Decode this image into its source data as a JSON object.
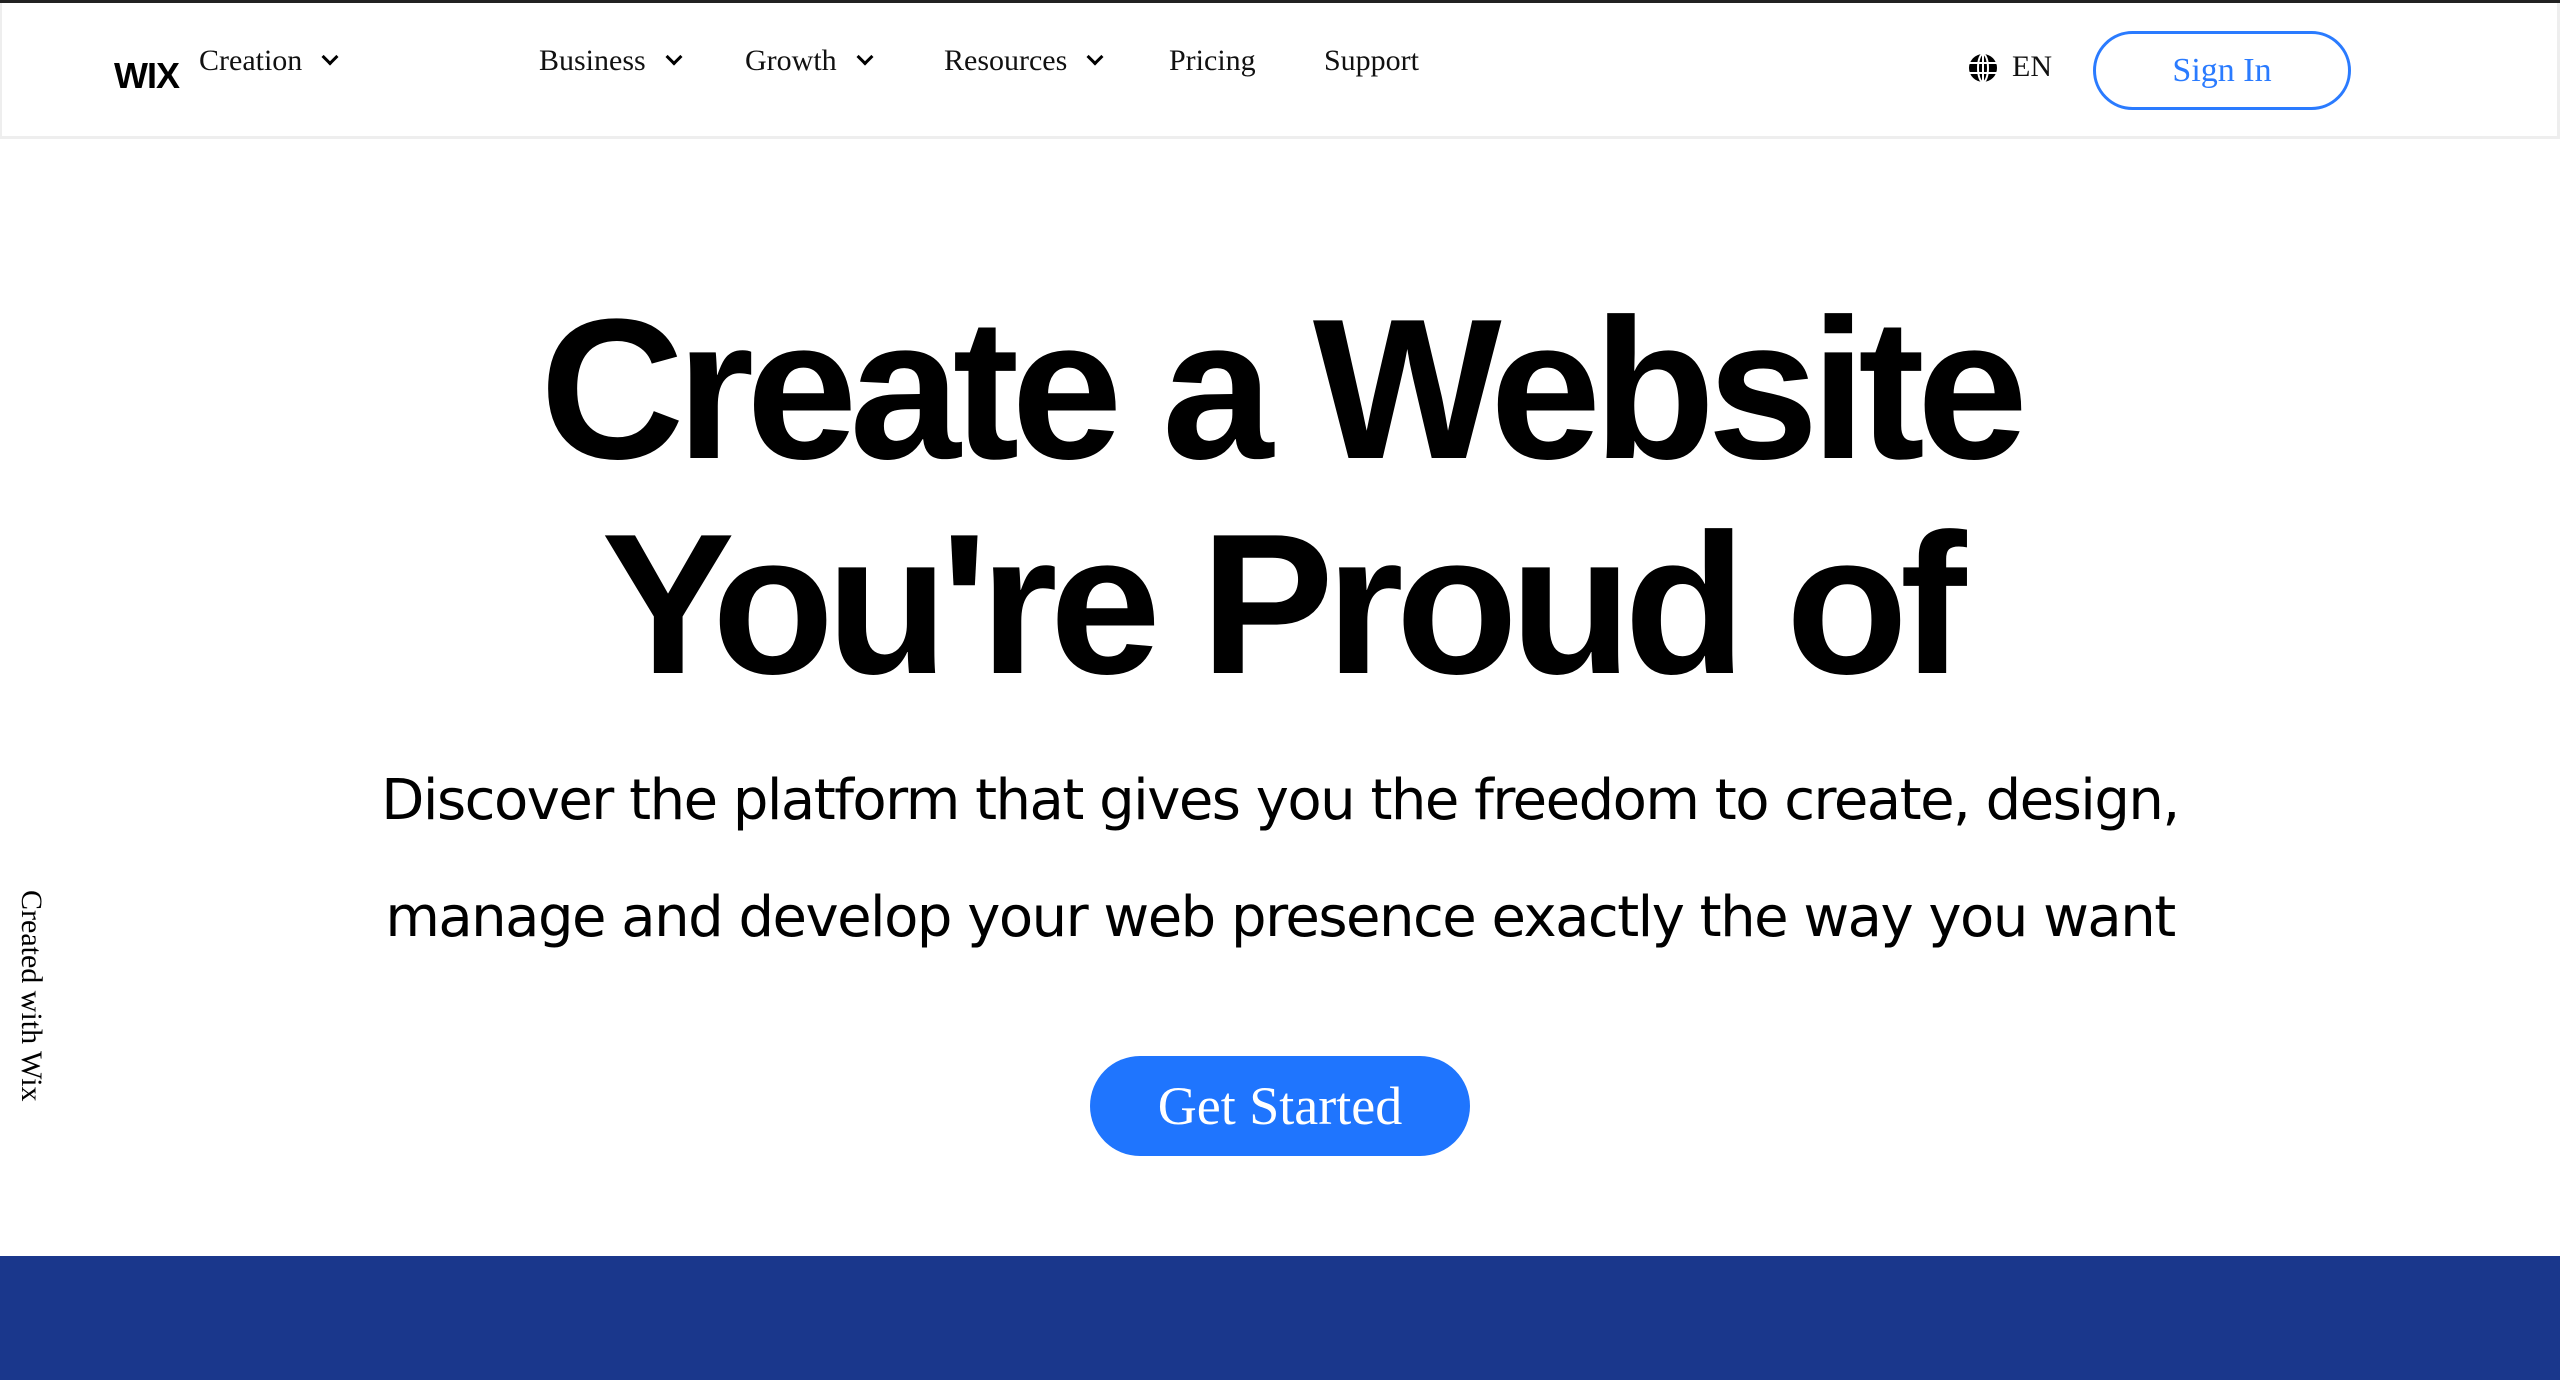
{
  "header": {
    "logo": "WIX",
    "nav": [
      {
        "label": "Creation",
        "dropdown": true
      },
      {
        "label": "Business",
        "dropdown": true
      },
      {
        "label": "Growth",
        "dropdown": true
      },
      {
        "label": "Resources",
        "dropdown": true
      },
      {
        "label": "Pricing",
        "dropdown": false
      },
      {
        "label": "Support",
        "dropdown": false
      }
    ],
    "language": "EN",
    "language_icon": "globe-icon",
    "sign_in": "Sign In"
  },
  "hero": {
    "title_line1": "Create a Website",
    "title_line2": "You're Proud of",
    "subtitle_line1": "Discover the platform that gives you the freedom to create, design,",
    "subtitle_line2": "manage and develop your web presence exactly the way you want",
    "cta": "Get Started"
  },
  "side_label": "Created with Wix",
  "colors": {
    "accent": "#1f75fe",
    "band": "#1a378c",
    "sign_in_border": "#2a7bff"
  }
}
